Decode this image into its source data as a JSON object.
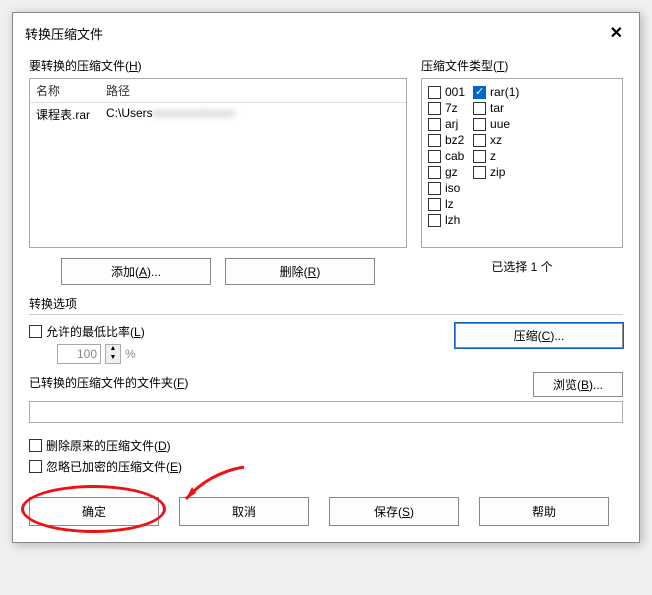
{
  "title": "转换压缩文件",
  "left": {
    "label_pre": "要转换的压缩文件(",
    "label_u": "H",
    "label_post": ")",
    "col_name": "名称",
    "col_path": "路径",
    "row_name": "课程表.rar",
    "row_path_visible": "C:\\Users",
    "row_path_hidden": "\\xxxxxxxx\\xxxx\\",
    "add_pre": "添加(",
    "add_u": "A",
    "add_post": ")...",
    "remove_pre": "删除(",
    "remove_u": "R",
    "remove_post": ")"
  },
  "right": {
    "label_pre": "压缩文件类型(",
    "label_u": "T",
    "label_post": ")",
    "types_col1": [
      "001",
      "7z",
      "arj",
      "bz2",
      "cab",
      "gz",
      "iso",
      "lz",
      "lzh"
    ],
    "types_col2": [
      "rar(1)",
      "tar",
      "uue",
      "xz",
      "z",
      "zip"
    ],
    "checked": "rar(1)",
    "selected_count": "已选择 1 个"
  },
  "options": {
    "section": "转换选项",
    "allow_ratio_pre": "允许的最低比率(",
    "allow_ratio_u": "L",
    "allow_ratio_post": ")",
    "ratio_value": "100",
    "percent": "%",
    "compress_pre": "压缩(",
    "compress_u": "C",
    "compress_post": ")...",
    "folder_label_pre": "已转换的压缩文件的文件夹(",
    "folder_label_u": "F",
    "folder_label_post": ")",
    "folder_value": "",
    "browse_pre": "浏览(",
    "browse_u": "B",
    "browse_post": ")...",
    "del_pre": "删除原来的压缩文件(",
    "del_u": "D",
    "del_post": ")",
    "skip_pre": "忽略已加密的压缩文件(",
    "skip_u": "E",
    "skip_post": ")"
  },
  "buttons": {
    "ok": "确定",
    "cancel": "取消",
    "save_pre": "保存(",
    "save_u": "S",
    "save_post": ")",
    "help": "帮助"
  }
}
